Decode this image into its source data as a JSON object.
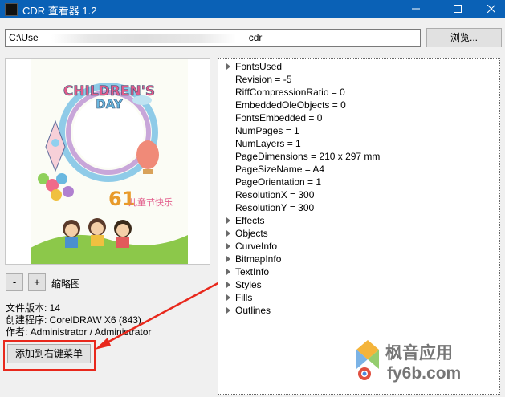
{
  "window": {
    "title": "CDR 查看器 1.2",
    "controls": {
      "minimize_icon": "minimize-icon",
      "maximize_icon": "maximize-icon",
      "close_icon": "close-icon"
    }
  },
  "toolbar": {
    "path_prefix": "C:\\Use",
    "path_suffix": "cdr",
    "browse_label": "浏览..."
  },
  "preview": {
    "art": {
      "heading_line1": "CHILDREN'S",
      "heading_line2": "DAY",
      "number": "61",
      "subtitle": "儿童节快乐"
    },
    "zoom_out_label": "-",
    "zoom_in_label": "+",
    "thumbnail_label": "缩略图"
  },
  "file_info": {
    "version": "文件版本: 14",
    "creator": "创建程序: CorelDRAW X6 (843)",
    "author": "作者: Administrator / Administrator"
  },
  "actions": {
    "add_context_menu_label": "添加到右键菜单",
    "highlight_color": "#e8281c"
  },
  "tree": {
    "items": [
      {
        "label": "FontsUsed",
        "expandable": true
      },
      {
        "label": "Revision = -5",
        "expandable": false
      },
      {
        "label": "RiffCompressionRatio = 0",
        "expandable": false
      },
      {
        "label": "EmbeddedOleObjects = 0",
        "expandable": false
      },
      {
        "label": "FontsEmbedded = 0",
        "expandable": false
      },
      {
        "label": "NumPages = 1",
        "expandable": false
      },
      {
        "label": "NumLayers = 1",
        "expandable": false
      },
      {
        "label": "PageDimensions = 210 x 297 mm",
        "expandable": false
      },
      {
        "label": "PageSizeName = A4",
        "expandable": false
      },
      {
        "label": "PageOrientation = 1",
        "expandable": false
      },
      {
        "label": "ResolutionX = 300",
        "expandable": false
      },
      {
        "label": "ResolutionY = 300",
        "expandable": false
      },
      {
        "label": "Effects",
        "expandable": true
      },
      {
        "label": "Objects",
        "expandable": true
      },
      {
        "label": "CurveInfo",
        "expandable": true
      },
      {
        "label": "BitmapInfo",
        "expandable": true
      },
      {
        "label": "TextInfo",
        "expandable": true
      },
      {
        "label": "Styles",
        "expandable": true
      },
      {
        "label": "Fills",
        "expandable": true
      },
      {
        "label": "Outlines",
        "expandable": true
      }
    ]
  },
  "watermark": {
    "line1": "枫音应用",
    "line2": "fy6b.com"
  },
  "colors": {
    "titlebar": "#0a61b6",
    "annotation_red": "#e8281c"
  }
}
